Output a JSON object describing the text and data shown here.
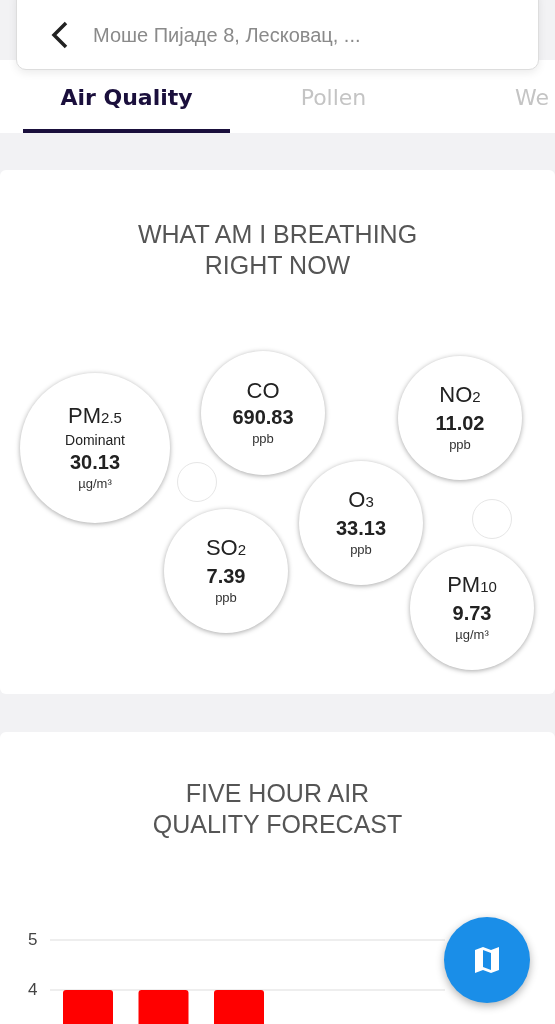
{
  "search": {
    "value": "Моше Пијаде 8, Лесковац, ..."
  },
  "tabs": [
    {
      "label": "Air Quality",
      "selected": true
    },
    {
      "label": "Pollen",
      "selected": false
    },
    {
      "label": "We",
      "selected": false
    }
  ],
  "breathing": {
    "title": "WHAT AM I BREATHING RIGHT NOW",
    "pollutants": [
      {
        "name": "PM$_{2.5}$",
        "note": "Dominant",
        "value": "30.13",
        "unit": "µg/m³"
      },
      {
        "name": "CO",
        "value": "690.83",
        "unit": "ppb"
      },
      {
        "name": "NO$_{2}$",
        "value": "11.02",
        "unit": "ppb"
      },
      {
        "name": "O$_{3}$",
        "value": "33.13",
        "unit": "ppb"
      },
      {
        "name": "SO$_{2}$",
        "value": "7.39",
        "unit": "ppb"
      },
      {
        "name": "PM$_{10}$",
        "value": "9.73",
        "unit": "µg/m³"
      }
    ]
  },
  "forecast": {
    "title": "FIVE HOUR AIR QUALITY FORECAST",
    "axis_labels": [
      "5",
      "4"
    ]
  }
}
